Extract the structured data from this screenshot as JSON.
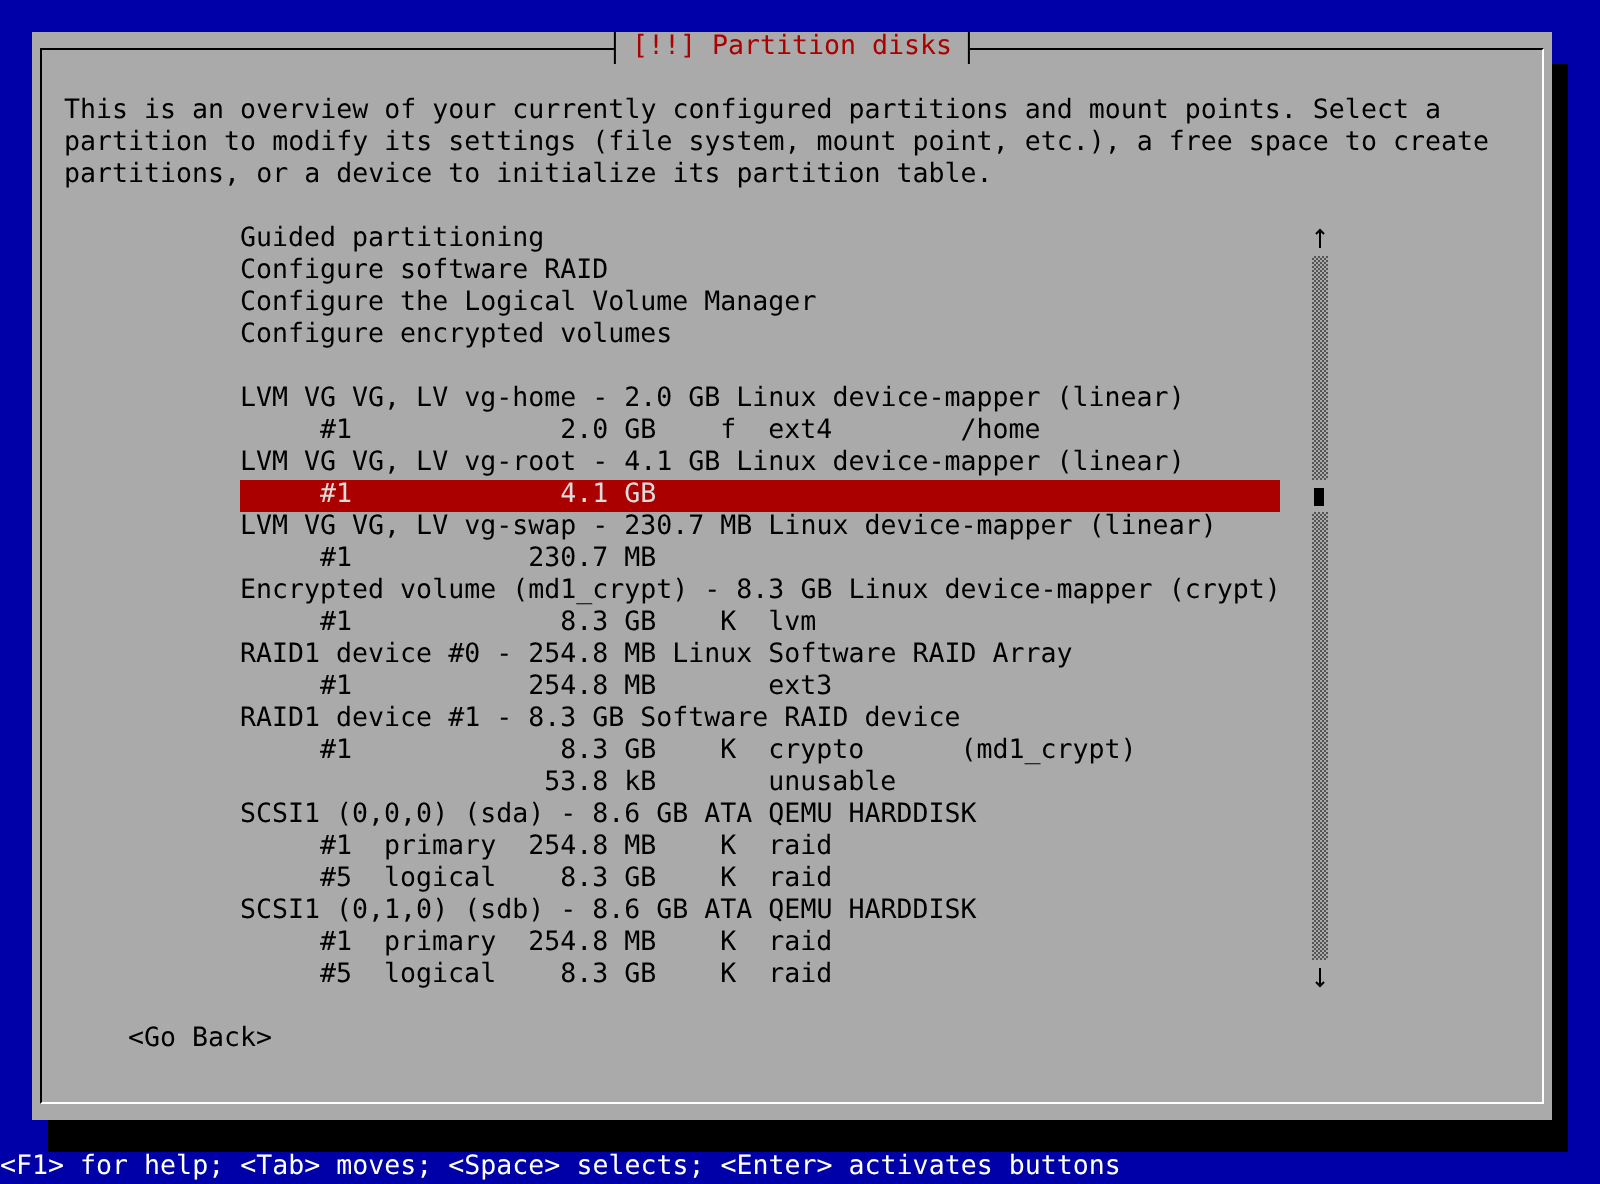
{
  "dialog": {
    "title": "[!!] Partition disks",
    "description": "This is an overview of your currently configured partitions and mount points. Select a partition to modify its settings (file system, mount point, etc.), a free space to create partitions, or a device to initialize its partition table.",
    "menu": [
      {
        "label": "Guided partitioning",
        "selected": false
      },
      {
        "label": "Configure software RAID",
        "selected": false
      },
      {
        "label": "Configure the Logical Volume Manager",
        "selected": false
      },
      {
        "label": "Configure encrypted volumes",
        "selected": false
      }
    ],
    "devices": [
      {
        "label": "LVM VG VG, LV vg-home - 2.0 GB Linux device-mapper (linear)",
        "selected": false,
        "partitions": [
          {
            "number": "#1",
            "size": "2.0 GB",
            "flag": "f",
            "fs": "ext4",
            "mount": "/home",
            "selected": false
          }
        ]
      },
      {
        "label": "LVM VG VG, LV vg-root - 4.1 GB Linux device-mapper (linear)",
        "selected": false,
        "partitions": [
          {
            "number": "#1",
            "size": "4.1 GB",
            "selected": true
          }
        ]
      },
      {
        "label": "LVM VG VG, LV vg-swap - 230.7 MB Linux device-mapper (linear)",
        "selected": false,
        "partitions": [
          {
            "number": "#1",
            "size": "230.7 MB",
            "selected": false
          }
        ]
      },
      {
        "label": "Encrypted volume (md1_crypt) - 8.3 GB Linux device-mapper (crypt)",
        "selected": false,
        "partitions": [
          {
            "number": "#1",
            "size": "8.3 GB",
            "flag": "K",
            "fs": "lvm",
            "selected": false
          }
        ]
      },
      {
        "label": "RAID1 device #0 - 254.8 MB Linux Software RAID Array",
        "selected": false,
        "partitions": [
          {
            "number": "#1",
            "size": "254.8 MB",
            "fs": "ext3",
            "selected": false
          }
        ]
      },
      {
        "label": "RAID1 device #1 - 8.3 GB Software RAID device",
        "selected": false,
        "partitions": [
          {
            "number": "#1",
            "size": "8.3 GB",
            "flag": "K",
            "fs": "crypto",
            "mount": "(md1_crypt)",
            "selected": false
          },
          {
            "size": "53.8 kB",
            "fs": "unusable",
            "selected": false
          }
        ]
      },
      {
        "label": "SCSI1 (0,0,0) (sda) - 8.6 GB ATA QEMU HARDDISK",
        "selected": false,
        "partitions": [
          {
            "number": "#1",
            "type": "primary",
            "size": "254.8 MB",
            "flag": "K",
            "fs": "raid",
            "selected": false
          },
          {
            "number": "#5",
            "type": "logical",
            "size": "8.3 GB",
            "flag": "K",
            "fs": "raid",
            "selected": false
          }
        ]
      },
      {
        "label": "SCSI1 (0,1,0) (sdb) - 8.6 GB ATA QEMU HARDDISK",
        "selected": false,
        "partitions": [
          {
            "number": "#1",
            "type": "primary",
            "size": "254.8 MB",
            "flag": "K",
            "fs": "raid",
            "selected": false
          },
          {
            "number": "#5",
            "type": "logical",
            "size": "8.3 GB",
            "flag": "K",
            "fs": "raid",
            "selected": false
          }
        ]
      }
    ],
    "buttons": [
      {
        "label": "<Go Back>",
        "selected": false
      }
    ]
  },
  "status_bar": "<F1> for help; <Tab> moves; <Space> selects; <Enter> activates buttons"
}
